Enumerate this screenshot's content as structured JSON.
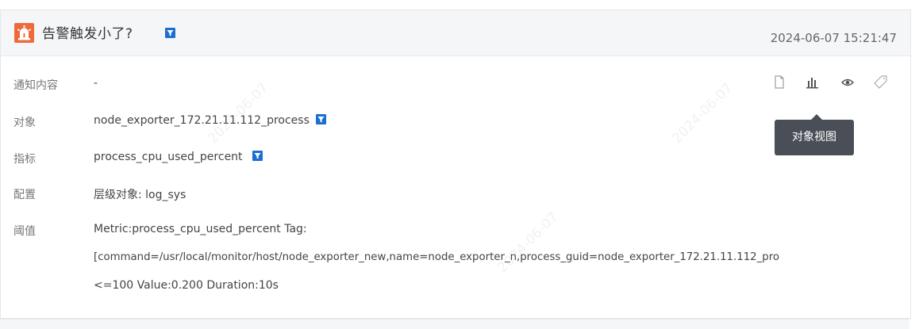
{
  "alert": {
    "title": "告警触发小了?",
    "timestamp": "2024-06-07 15:21:47"
  },
  "fields": [
    {
      "label": "通知内容",
      "value": "-"
    },
    {
      "label": "对象",
      "value": "node_exporter_172.21.11.112_process"
    },
    {
      "label": "指标",
      "value": "process_cpu_used_percent"
    },
    {
      "label": "配置",
      "value": "层级对象: log_sys"
    },
    {
      "label": "阈值",
      "value": "Metric:process_cpu_used_percent Tag:"
    }
  ],
  "threshold_lines": [
    "[command=/usr/local/monitor/host/node_exporter_new,name=node_exporter_n,process_guid=node_exporter_172.21.11.112_pro",
    "<=100 Value:0.200 Duration:10s"
  ],
  "actions": {
    "tooltip": "对象视图",
    "icons": [
      "copy-icon",
      "chart-view-icon",
      "eye-icon",
      "tag-icon"
    ]
  },
  "watermark": "2024-06-07",
  "colors": {
    "alarm": "#ee6a3b",
    "filter": "#1a6fd2",
    "header_bg": "#f5f6f7",
    "tooltip_bg": "#4a4f57"
  }
}
